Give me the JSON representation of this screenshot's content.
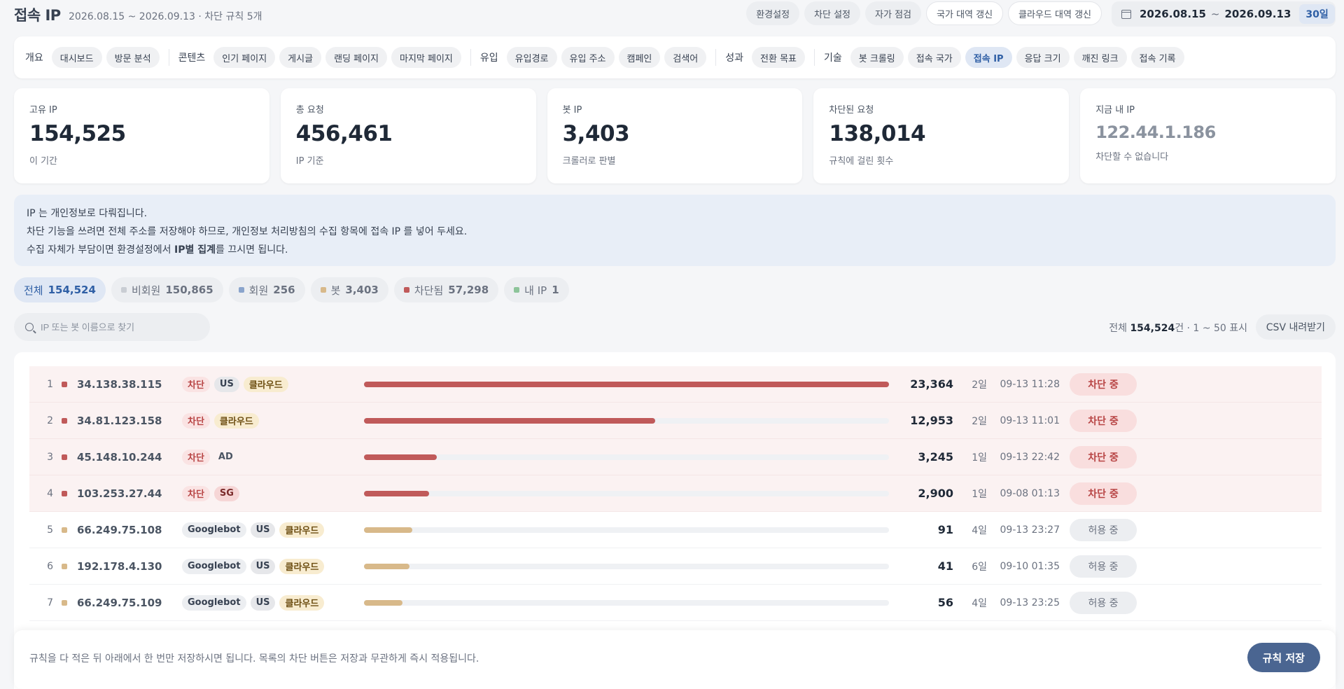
{
  "header": {
    "title": "접속 IP",
    "subtitle": "2026.08.15 ~ 2026.09.13 · 차단 규칙 5개",
    "actions": [
      "환경설정",
      "차단 설정",
      "자가 점검",
      "국가 대역 갱신",
      "클라우드 대역 갱신"
    ],
    "date_start": "2026.08.15",
    "date_sep": "~",
    "date_end": "2026.09.13",
    "days": "30일"
  },
  "nav": {
    "groups": [
      {
        "label": "개요",
        "items": [
          "대시보드",
          "방문 분석"
        ]
      },
      {
        "label": "콘텐츠",
        "items": [
          "인기 페이지",
          "게시글",
          "랜딩 페이지",
          "마지막 페이지"
        ]
      },
      {
        "label": "유입",
        "items": [
          "유입경로",
          "유입 주소",
          "캠페인",
          "검색어"
        ]
      },
      {
        "label": "성과",
        "items": [
          "전환 목표"
        ]
      },
      {
        "label": "기술",
        "items": [
          "봇 크롤링",
          "접속 국가",
          "접속 IP",
          "응답 크기",
          "깨진 링크",
          "접속 기록"
        ]
      }
    ],
    "active": "접속 IP"
  },
  "stats": [
    {
      "label": "고유 IP",
      "value": "154,525",
      "note": "이 기간"
    },
    {
      "label": "총 요청",
      "value": "456,461",
      "note": "IP 기준"
    },
    {
      "label": "봇 IP",
      "value": "3,403",
      "note": "크롤러로 판별"
    },
    {
      "label": "차단된 요청",
      "value": "138,014",
      "note": "규칙에 걸린 횟수"
    },
    {
      "label": "지금 내 IP",
      "value": "122.44.1.186",
      "note": "차단할 수 없습니다"
    }
  ],
  "notice": {
    "line1": "IP 는 개인정보로 다뤄집니다.",
    "line2": "차단 기능을 쓰려면 전체 주소를 저장해야 하므로, 개인정보 처리방침의 수집 항목에 접속 IP 를 넣어 두세요.",
    "line3_pre": "수집 자체가 부담이면 환경설정에서 ",
    "line3_bold": "IP별 집계",
    "line3_post": "를 끄시면 됩니다."
  },
  "filters": [
    {
      "label": "전체",
      "count": "154,524",
      "color": ""
    },
    {
      "label": "비회원",
      "count": "150,865",
      "color": "#c9cdd3"
    },
    {
      "label": "회원",
      "count": "256",
      "color": "#8aa4cc"
    },
    {
      "label": "봇",
      "count": "3,403",
      "color": "#d8b98a"
    },
    {
      "label": "차단됨",
      "count": "57,298",
      "color": "#c05a5a"
    },
    {
      "label": "내 IP",
      "count": "1",
      "color": "#8dc49a"
    }
  ],
  "search": {
    "placeholder": "IP 또는 봇 이름으로 찾기"
  },
  "results": {
    "prefix": "전체 ",
    "total": "154,524",
    "suffix": "건 · 1 ~ 50 표시"
  },
  "csv_label": "CSV 내려받기",
  "rows": [
    {
      "idx": "1",
      "ip": "34.138.38.115",
      "tags": [
        {
          "t": "차단",
          "k": "block"
        },
        {
          "t": "US",
          "k": "country"
        },
        {
          "t": "클라우드",
          "k": "cloud"
        }
      ],
      "bar": 1.0,
      "count": "23,364",
      "age": "2일",
      "ts": "09-13 11:28",
      "status": "차단 중",
      "blocked": true
    },
    {
      "idx": "2",
      "ip": "34.81.123.158",
      "tags": [
        {
          "t": "차단",
          "k": "block"
        },
        {
          "t": "클라우드",
          "k": "cloud"
        }
      ],
      "bar": 0.554,
      "count": "12,953",
      "age": "2일",
      "ts": "09-13 11:01",
      "status": "차단 중",
      "blocked": true
    },
    {
      "idx": "3",
      "ip": "45.148.10.244",
      "tags": [
        {
          "t": "차단",
          "k": "block"
        },
        {
          "t": "AD",
          "k": "plain"
        }
      ],
      "bar": 0.139,
      "count": "3,245",
      "age": "1일",
      "ts": "09-13 22:42",
      "status": "차단 중",
      "blocked": true
    },
    {
      "idx": "4",
      "ip": "103.253.27.44",
      "tags": [
        {
          "t": "차단",
          "k": "block"
        },
        {
          "t": "SG",
          "k": "country-red"
        }
      ],
      "bar": 0.124,
      "count": "2,900",
      "age": "1일",
      "ts": "09-08 01:13",
      "status": "차단 중",
      "blocked": true
    },
    {
      "idx": "5",
      "ip": "66.249.75.108",
      "tags": [
        {
          "t": "Googlebot",
          "k": "bot"
        },
        {
          "t": "US",
          "k": "country"
        },
        {
          "t": "클라우드",
          "k": "cloud"
        }
      ],
      "bar": 0.092,
      "count": "91",
      "age": "4일",
      "ts": "09-13 23:27",
      "status": "허용 중",
      "blocked": false
    },
    {
      "idx": "6",
      "ip": "192.178.4.130",
      "tags": [
        {
          "t": "Googlebot",
          "k": "bot"
        },
        {
          "t": "US",
          "k": "country"
        },
        {
          "t": "클라우드",
          "k": "cloud"
        }
      ],
      "bar": 0.086,
      "count": "41",
      "age": "6일",
      "ts": "09-10 01:35",
      "status": "허용 중",
      "blocked": false
    },
    {
      "idx": "7",
      "ip": "66.249.75.109",
      "tags": [
        {
          "t": "Googlebot",
          "k": "bot"
        },
        {
          "t": "US",
          "k": "country"
        },
        {
          "t": "클라우드",
          "k": "cloud"
        }
      ],
      "bar": 0.073,
      "count": "56",
      "age": "4일",
      "ts": "09-13 23:25",
      "status": "허용 중",
      "blocked": false
    }
  ],
  "footer": {
    "text": "규칙을 다 적은 뒤 아래에서 한 번만 저장하시면 됩니다. 목록의 차단 버튼은 저장과 무관하게 즉시 적용됩니다.",
    "save_label": "규칙 저장"
  },
  "colors": {
    "accent": "#4a6591",
    "blocked": "#c05a5a",
    "bot": "#d8b98a"
  }
}
